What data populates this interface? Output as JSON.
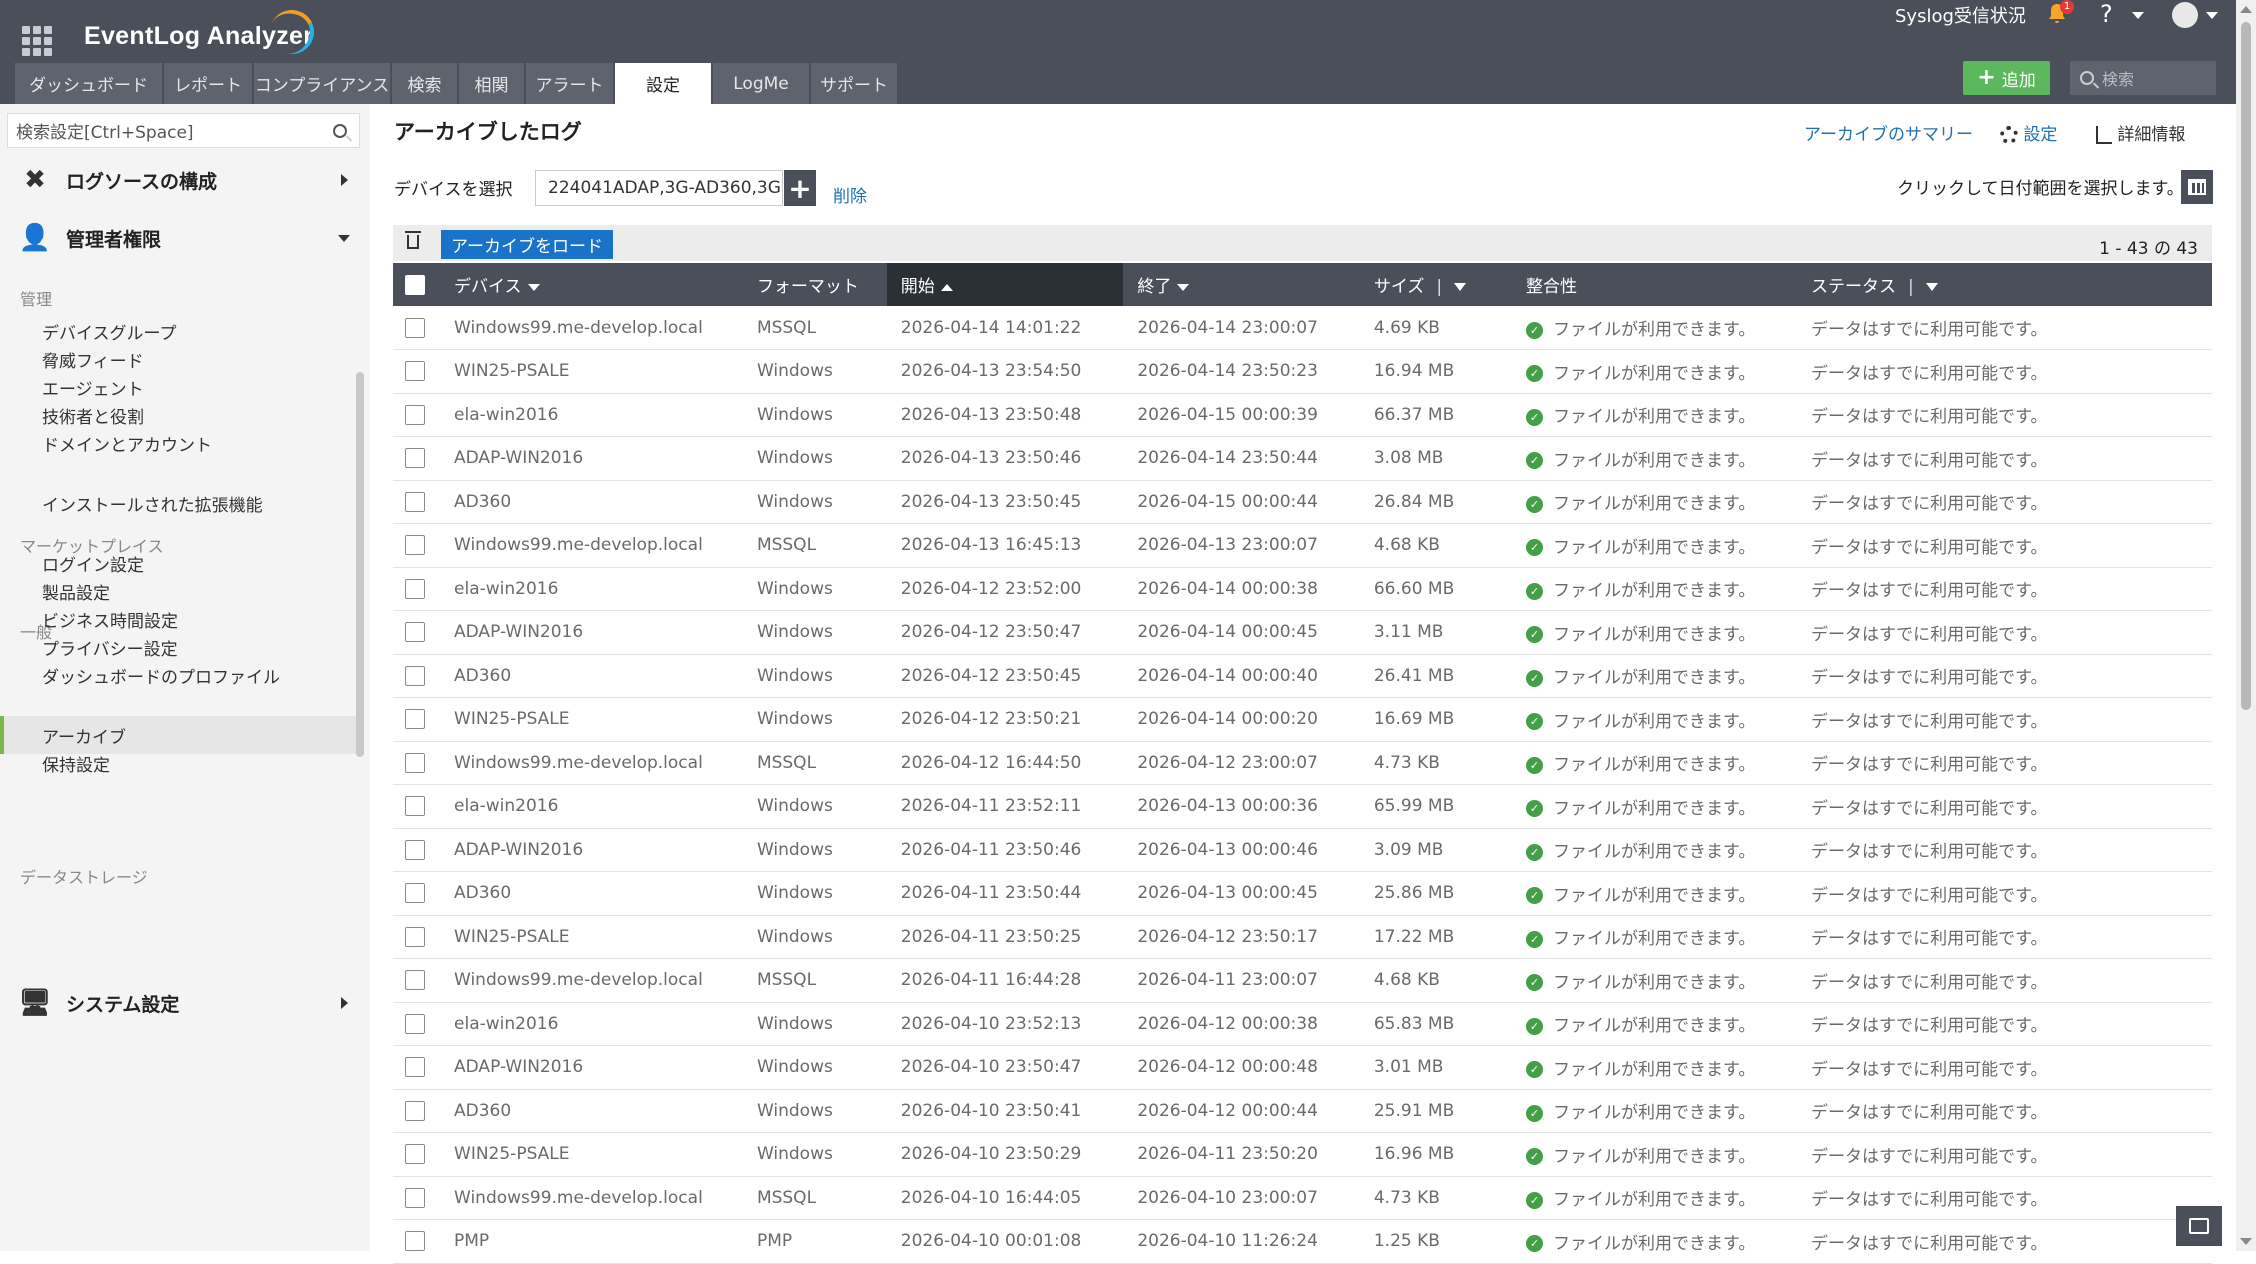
{
  "app": {
    "title": "EventLog Analyzer"
  },
  "header": {
    "syslog_status": "Syslog受信状況",
    "notification_count": "1",
    "help": "?",
    "add_button": "追加",
    "search_placeholder": "検索"
  },
  "tabs": [
    {
      "label": "ダッシュボード",
      "w": 147
    },
    {
      "label": "レポート",
      "w": 88
    },
    {
      "label": "コンプライアンス",
      "w": 136
    },
    {
      "label": "検索",
      "w": 65
    },
    {
      "label": "相関",
      "w": 65
    },
    {
      "label": "アラート",
      "w": 87
    },
    {
      "label": "設定",
      "w": 96
    },
    {
      "label": "LogMe",
      "w": 96
    },
    {
      "label": "サポート",
      "w": 86
    }
  ],
  "active_tab": "設定",
  "sidebar": {
    "search_placeholder": "検索設定[Ctrl+Space]",
    "group1": "ログソースの構成",
    "group2": "管理者権限",
    "section_admin": "管理",
    "admin_items": [
      "デバイスグループ",
      "脅威フィード",
      "エージェント",
      "技術者と役割",
      "ドメインとアカウント"
    ],
    "section_market": "マーケットプレイス",
    "market_items": [
      "インストールされた拡張機能"
    ],
    "section_general": "一般",
    "general_items": [
      "ログイン設定",
      "製品設定",
      "ビジネス時間設定",
      "プライバシー設定",
      "ダッシュボードのプロファイル"
    ],
    "section_storage": "データストレージ",
    "storage_items": [
      "アーカイブ",
      "保持設定"
    ],
    "group3": "システム設定"
  },
  "page": {
    "title": "アーカイブしたログ",
    "summary_link": "アーカイブのサマリー",
    "settings_link": "設定",
    "detail_link": "詳細情報",
    "device_label": "デバイスを選択",
    "device_value": "224041ADAP,3G-AD360,3G",
    "delete_link": "削除",
    "date_range_label": "クリックして日付範囲を選択します。",
    "load_button": "アーカイブをロード",
    "pager": "1 - 43 の 43"
  },
  "table": {
    "columns": [
      "デバイス",
      "フォーマット",
      "開始",
      "終了",
      "サイズ",
      "整合性",
      "ステータス"
    ],
    "sorted_column": "開始",
    "rows": [
      [
        "Windows99.me-develop.local",
        "MSSQL",
        "2026-04-14 14:01:22",
        "2026-04-14 23:00:07",
        "4.69 KB",
        "ファイルが利用できます。",
        "データはすでに利用可能です。"
      ],
      [
        "WIN25-PSALE",
        "Windows",
        "2026-04-13 23:54:50",
        "2026-04-14 23:50:23",
        "16.94 MB",
        "ファイルが利用できます。",
        "データはすでに利用可能です。"
      ],
      [
        "ela-win2016",
        "Windows",
        "2026-04-13 23:50:48",
        "2026-04-15 00:00:39",
        "66.37 MB",
        "ファイルが利用できます。",
        "データはすでに利用可能です。"
      ],
      [
        "ADAP-WIN2016",
        "Windows",
        "2026-04-13 23:50:46",
        "2026-04-14 23:50:44",
        "3.08 MB",
        "ファイルが利用できます。",
        "データはすでに利用可能です。"
      ],
      [
        "AD360",
        "Windows",
        "2026-04-13 23:50:45",
        "2026-04-15 00:00:44",
        "26.84 MB",
        "ファイルが利用できます。",
        "データはすでに利用可能です。"
      ],
      [
        "Windows99.me-develop.local",
        "MSSQL",
        "2026-04-13 16:45:13",
        "2026-04-13 23:00:07",
        "4.68 KB",
        "ファイルが利用できます。",
        "データはすでに利用可能です。"
      ],
      [
        "ela-win2016",
        "Windows",
        "2026-04-12 23:52:00",
        "2026-04-14 00:00:38",
        "66.60 MB",
        "ファイルが利用できます。",
        "データはすでに利用可能です。"
      ],
      [
        "ADAP-WIN2016",
        "Windows",
        "2026-04-12 23:50:47",
        "2026-04-14 00:00:45",
        "3.11 MB",
        "ファイルが利用できます。",
        "データはすでに利用可能です。"
      ],
      [
        "AD360",
        "Windows",
        "2026-04-12 23:50:45",
        "2026-04-14 00:00:40",
        "26.41 MB",
        "ファイルが利用できます。",
        "データはすでに利用可能です。"
      ],
      [
        "WIN25-PSALE",
        "Windows",
        "2026-04-12 23:50:21",
        "2026-04-14 00:00:20",
        "16.69 MB",
        "ファイルが利用できます。",
        "データはすでに利用可能です。"
      ],
      [
        "Windows99.me-develop.local",
        "MSSQL",
        "2026-04-12 16:44:50",
        "2026-04-12 23:00:07",
        "4.73 KB",
        "ファイルが利用できます。",
        "データはすでに利用可能です。"
      ],
      [
        "ela-win2016",
        "Windows",
        "2026-04-11 23:52:11",
        "2026-04-13 00:00:36",
        "65.99 MB",
        "ファイルが利用できます。",
        "データはすでに利用可能です。"
      ],
      [
        "ADAP-WIN2016",
        "Windows",
        "2026-04-11 23:50:46",
        "2026-04-13 00:00:46",
        "3.09 MB",
        "ファイルが利用できます。",
        "データはすでに利用可能です。"
      ],
      [
        "AD360",
        "Windows",
        "2026-04-11 23:50:44",
        "2026-04-13 00:00:45",
        "25.86 MB",
        "ファイルが利用できます。",
        "データはすでに利用可能です。"
      ],
      [
        "WIN25-PSALE",
        "Windows",
        "2026-04-11 23:50:25",
        "2026-04-12 23:50:17",
        "17.22 MB",
        "ファイルが利用できます。",
        "データはすでに利用可能です。"
      ],
      [
        "Windows99.me-develop.local",
        "MSSQL",
        "2026-04-11 16:44:28",
        "2026-04-11 23:00:07",
        "4.68 KB",
        "ファイルが利用できます。",
        "データはすでに利用可能です。"
      ],
      [
        "ela-win2016",
        "Windows",
        "2026-04-10 23:52:13",
        "2026-04-12 00:00:38",
        "65.83 MB",
        "ファイルが利用できます。",
        "データはすでに利用可能です。"
      ],
      [
        "ADAP-WIN2016",
        "Windows",
        "2026-04-10 23:50:47",
        "2026-04-12 00:00:48",
        "3.01 MB",
        "ファイルが利用できます。",
        "データはすでに利用可能です。"
      ],
      [
        "AD360",
        "Windows",
        "2026-04-10 23:50:41",
        "2026-04-12 00:00:44",
        "25.91 MB",
        "ファイルが利用できます。",
        "データはすでに利用可能です。"
      ],
      [
        "WIN25-PSALE",
        "Windows",
        "2026-04-10 23:50:29",
        "2026-04-11 23:50:20",
        "16.96 MB",
        "ファイルが利用できます。",
        "データはすでに利用可能です。"
      ],
      [
        "Windows99.me-develop.local",
        "MSSQL",
        "2026-04-10 16:44:05",
        "2026-04-10 23:00:07",
        "4.73 KB",
        "ファイルが利用できます。",
        "データはすでに利用可能です。"
      ],
      [
        "PMP",
        "PMP",
        "2026-04-10 00:01:08",
        "2026-04-10 11:26:24",
        "1.25 KB",
        "ファイルが利用できます。",
        "データはすでに利用可能です。"
      ]
    ]
  },
  "colors": {
    "header_bg": "#4a4f59",
    "accent_link": "#1d6fb8",
    "add_green": "#5cb85c",
    "load_blue": "#1a73c9",
    "ok_green": "#43a047"
  }
}
